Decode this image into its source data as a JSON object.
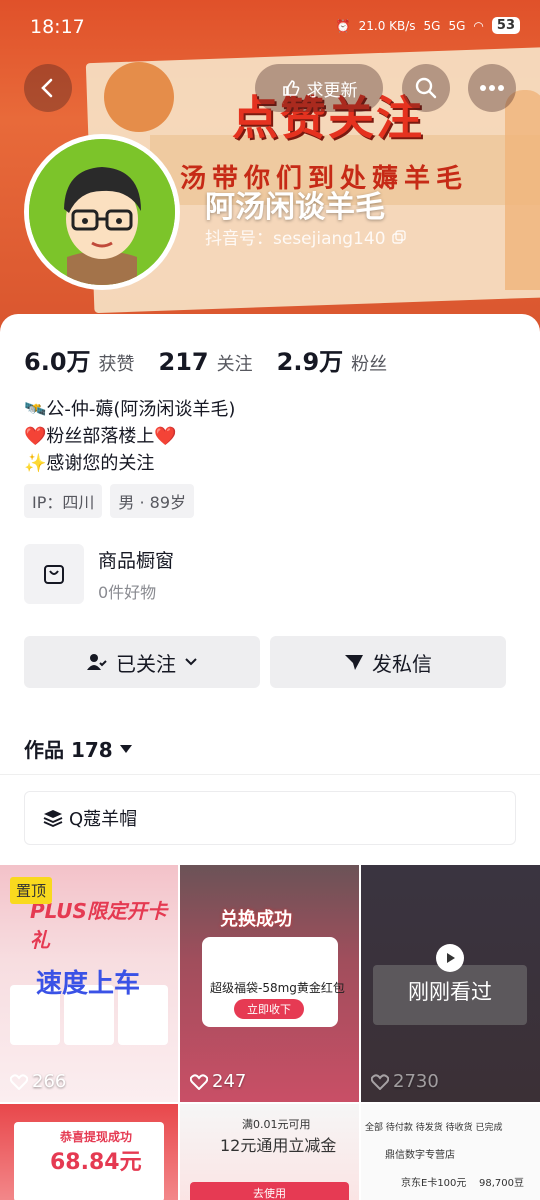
{
  "status_bar": {
    "time": "18:17",
    "net_speed": "21.0 KB/s",
    "signal1": "5G",
    "signal2": "5G",
    "battery": "53"
  },
  "nav": {
    "update_label": "求更新"
  },
  "banner": {
    "headline": "点赞关注",
    "slogan": "汤带你们到处薅羊毛"
  },
  "profile": {
    "nickname": "阿汤闲谈羊毛",
    "douyin_id": "抖音号：sesejiang140"
  },
  "stats": [
    {
      "num": "6.0万",
      "label": "获赞"
    },
    {
      "num": "217",
      "label": "关注"
    },
    {
      "num": "2.9万",
      "label": "粉丝"
    }
  ],
  "bio": [
    "🛰️公-仲-薅(阿汤闲谈羊毛)",
    "❤️粉丝部落楼上❤️",
    "✨感谢您的关注"
  ],
  "tags": [
    "IP：四川",
    "男 · 89岁"
  ],
  "shop": {
    "title": "商品橱窗",
    "subtitle": "0件好物"
  },
  "actions": {
    "follow": "已关注",
    "message": "发私信"
  },
  "works": {
    "label": "作品 178"
  },
  "collection": {
    "label": "Q蔻羊帽"
  },
  "grid": [
    {
      "likes": "266",
      "badge": "置顶",
      "title": "PLUS限定开卡礼",
      "overlay": "速度上车"
    },
    {
      "likes": "247",
      "title": "兑换成功",
      "desc": "超级福袋-58mg黄金红包",
      "button": "立即收下"
    },
    {
      "likes": "2730",
      "overlay": "刚刚看过"
    },
    {
      "amount": "68.84元",
      "text": "恭喜提现成功"
    },
    {
      "title": "12元通用立减金",
      "sub": "满0.01元可用",
      "button": "去使用"
    },
    {
      "tabs": "全部  待付款  待发货  待收货  已完成",
      "shop": "鼎信数字专营店",
      "item": "京东E卡100元",
      "price": "98,700豆"
    }
  ],
  "colors": {
    "accent": "#e5321f",
    "pinned": "#f9d91e",
    "text": "#161823",
    "muted": "#57585f"
  }
}
